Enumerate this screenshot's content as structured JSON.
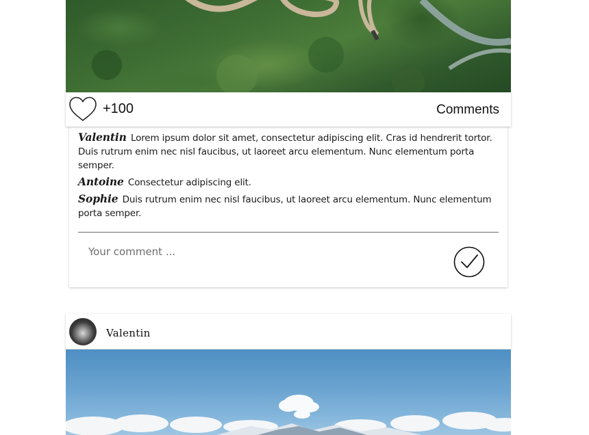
{
  "post1": {
    "likes": "+100",
    "comments_label": "Comments",
    "comments": [
      {
        "author": "Valentin",
        "text": "Lorem ipsum dolor sit amet, consectetur adipiscing elit. Cras id hendrerit tortor. Duis rutrum enim nec nisl faucibus, ut laoreet arcu elementum. Nunc elementum porta semper."
      },
      {
        "author": "Antoine",
        "text": "Consectetur adipiscing elit."
      },
      {
        "author": "Sophie",
        "text": "Duis rutrum enim nec nisl faucibus, ut laoreet arcu elementum. Nunc elementum porta semper."
      }
    ],
    "comment_placeholder": "Your comment ...",
    "icons": {
      "like": "heart-icon",
      "submit": "checkmark-circle-icon"
    }
  },
  "post2": {
    "author": "Valentin",
    "icons": {
      "avatar": "avatar"
    }
  }
}
